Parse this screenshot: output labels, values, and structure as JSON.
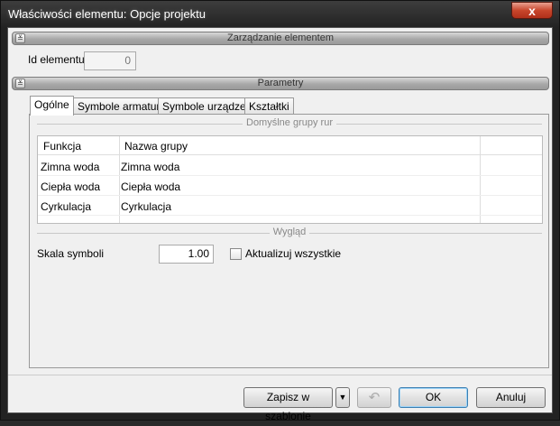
{
  "window": {
    "title": "Właściwości elementu: Opcje projektu",
    "close_glyph": "x"
  },
  "sections": {
    "management": {
      "label": "Zarządzanie elementem",
      "toggle_glyph": "≚"
    },
    "parameters": {
      "label": "Parametry",
      "toggle_glyph": "≚"
    }
  },
  "element_id": {
    "label": "Id elementu",
    "value": "0"
  },
  "tabs": [
    {
      "label": "Ogólne",
      "active": true
    },
    {
      "label": "Symbole armatury"
    },
    {
      "label": "Symbole urządzeń"
    },
    {
      "label": "Kształtki"
    }
  ],
  "pipe_groups": {
    "header": "Domyślne grupy rur",
    "columns": [
      "Funkcja",
      "Nazwa grupy"
    ],
    "rows": [
      [
        "Zimna woda",
        "Zimna woda"
      ],
      [
        "Ciepła woda",
        "Ciepła woda"
      ],
      [
        "Cyrkulacja",
        "Cyrkulacja"
      ]
    ]
  },
  "appearance": {
    "header": "Wygląd",
    "scale_label": "Skala symboli",
    "scale_value": "1.00",
    "update_all_label": "Aktualizuj wszystkie",
    "update_all_checked": false
  },
  "footer": {
    "save_template_label": "Zapisz w szablonie",
    "dropdown_glyph": "▼",
    "undo_glyph": "↶",
    "ok_label": "OK",
    "cancel_label": "Anuluj"
  }
}
